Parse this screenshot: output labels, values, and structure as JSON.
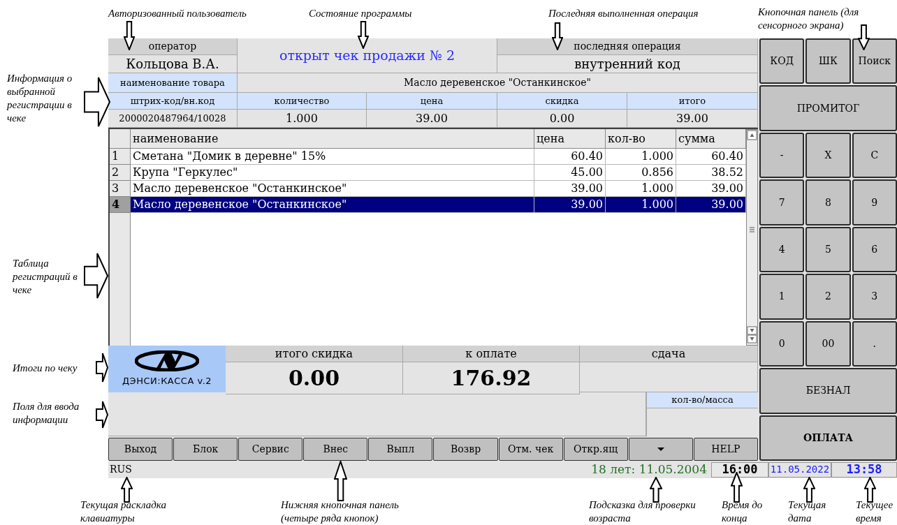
{
  "annotations": [
    {
      "text": "Авторизованный пользователь"
    },
    {
      "text": "Состояние программы"
    },
    {
      "text": "Последняя выполненная операция"
    },
    {
      "text": "Кнопочная панель (для сенсорного экрана)"
    },
    {
      "text": "Информация о выбранной регистрации в чеке"
    },
    {
      "text": "Таблица регистраций в чеке"
    },
    {
      "text": "Итоги по чеку"
    },
    {
      "text": "Поля для ввода информации"
    },
    {
      "text": "Текущая раскладка клавиатуры"
    },
    {
      "text": "Нижняя кнопочная панель (четыре ряда кнопок)"
    },
    {
      "text": "Подсказка для проверки возраста"
    },
    {
      "text": "Время до конца"
    },
    {
      "text": "Текущая дата"
    },
    {
      "text": "Текущее время"
    }
  ],
  "header": {
    "operator_label": "оператор",
    "operator": "Кольцова В.А.",
    "status": "открыт чек продажи № 2",
    "last_operation_label": "последняя операция",
    "last_operation": "внутренний код"
  },
  "selected_item": {
    "name_label": "наименование товара",
    "name": "Масло деревенское \"Останкинское\"",
    "fields": [
      {
        "label": "штрих-код/вн.код",
        "value": "2000020487964/10028"
      },
      {
        "label": "количество",
        "value": "1.000"
      },
      {
        "label": "цена",
        "value": "39.00"
      },
      {
        "label": "скидка",
        "value": "0.00"
      },
      {
        "label": "итого",
        "value": "39.00"
      }
    ]
  },
  "table": {
    "columns": [
      "наименование",
      "цена",
      "кол-во",
      "сумма"
    ],
    "rows": [
      {
        "number": "1",
        "cells": [
          "Сметана \"Домик в деревне\" 15%",
          "60.40",
          "1.000",
          "60.40"
        ],
        "selected": false
      },
      {
        "number": "2",
        "cells": [
          "Крупа \"Геркулес\"",
          "45.00",
          "0.856",
          "38.52"
        ],
        "selected": false
      },
      {
        "number": "3",
        "cells": [
          "Масло деревенское \"Останкинское\"",
          "39.00",
          "1.000",
          "39.00"
        ],
        "selected": false
      },
      {
        "number": "4",
        "cells": [
          "Масло деревенское \"Останкинское\"",
          "39.00",
          "1.000",
          "39.00"
        ],
        "selected": true
      }
    ]
  },
  "totals": {
    "logo_text": "ДЭНСИ:КАССА v.2",
    "items": [
      {
        "label": "итого скидка",
        "value": "0.00"
      },
      {
        "label": "к оплате",
        "value": "176.92"
      },
      {
        "label": "сдача"
      }
    ]
  },
  "input": {
    "label": "кол-во/масса"
  },
  "bottom_buttons": [
    {
      "kind": "text",
      "label": "Выход"
    },
    {
      "kind": "text",
      "label": "Блок"
    },
    {
      "kind": "text",
      "label": "Сервис"
    },
    {
      "kind": "text",
      "label": "Внес"
    },
    {
      "kind": "text",
      "label": "Выпл"
    },
    {
      "kind": "text",
      "label": "Возвр"
    },
    {
      "kind": "text",
      "label": "Отм. чек"
    },
    {
      "kind": "text",
      "label": "Откр.ящ"
    },
    {
      "kind": "dropdown"
    },
    {
      "kind": "text",
      "label": "HELP"
    }
  ],
  "keypad": [
    {
      "bold": false,
      "keys": [
        "КОД",
        "ШК",
        "Поиск"
      ]
    },
    {
      "bold": false,
      "keys": [
        "ПРОМИТОГ"
      ]
    },
    {
      "bold": false,
      "keys": [
        "-",
        "X",
        "C"
      ]
    },
    {
      "bold": false,
      "keys": [
        "7",
        "8",
        "9"
      ]
    },
    {
      "bold": false,
      "keys": [
        "4",
        "5",
        "6"
      ]
    },
    {
      "bold": false,
      "keys": [
        "1",
        "2",
        "3"
      ]
    },
    {
      "bold": false,
      "keys": [
        "0",
        "00",
        "."
      ]
    },
    {
      "bold": false,
      "keys": [
        "БЕЗНАЛ"
      ]
    },
    {
      "bold": true,
      "keys": [
        "ОПЛАТА"
      ]
    }
  ],
  "status_bar": {
    "layout": "RUS",
    "age_hint": "18 лет: 11.05.2004",
    "time_left": "16:00",
    "date": "11.05.2022",
    "time": "13:58"
  }
}
